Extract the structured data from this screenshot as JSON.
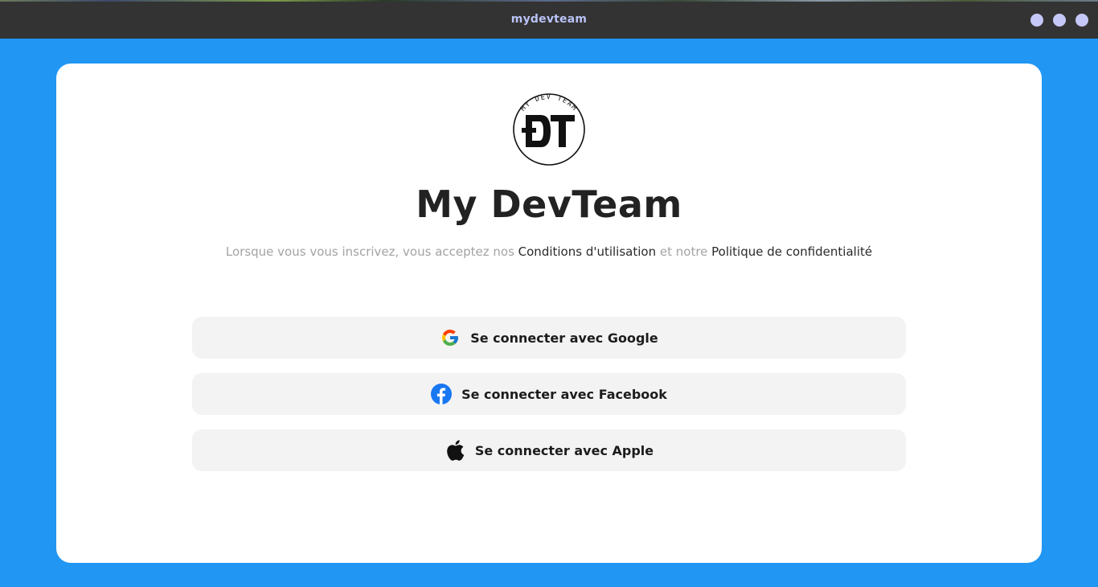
{
  "window": {
    "title": "mydevteam"
  },
  "app": {
    "name": "My DevTeam",
    "logo_ring_text": "MY DEV TEAM",
    "logo_initials": "DT"
  },
  "terms": {
    "prefix": "Lorsque vous vous inscrivez, vous acceptez nos ",
    "terms_link": "Conditions d'utilisation",
    "middle": " et notre ",
    "privacy_link": "Politique de confidentialité"
  },
  "buttons": {
    "google": {
      "label": "Se connecter avec Google",
      "icon": "google-icon"
    },
    "facebook": {
      "label": "Se connecter avec Facebook",
      "icon": "facebook-icon"
    },
    "apple": {
      "label": "Se connecter avec Apple",
      "icon": "apple-icon"
    }
  },
  "colors": {
    "background": "#2196f3",
    "titlebar": "#333333",
    "title_text": "#b9c3f5",
    "button_bg": "#f3f3f3",
    "facebook_blue": "#1877f2"
  }
}
